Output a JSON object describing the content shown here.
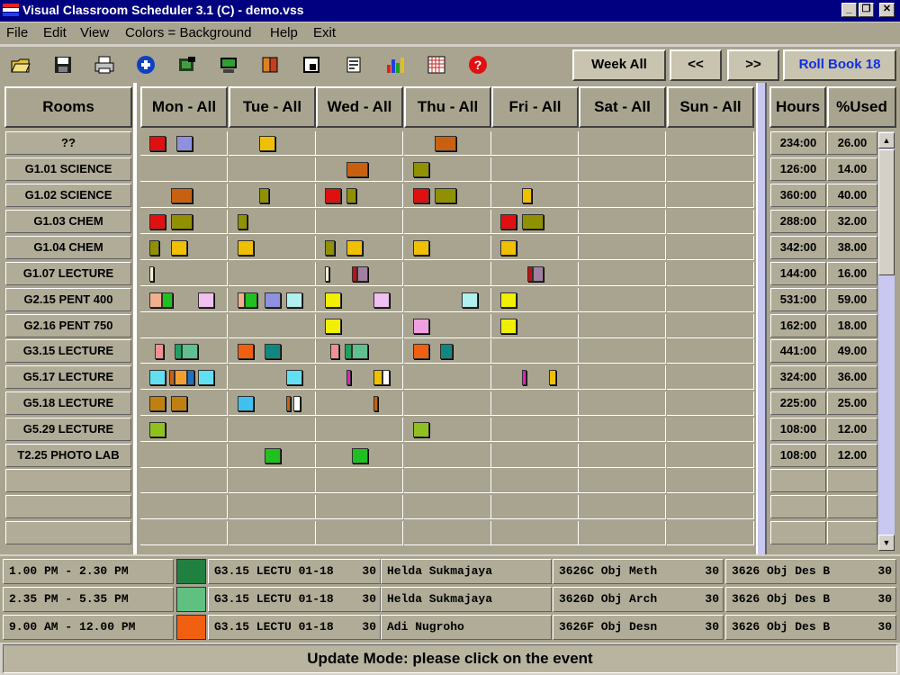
{
  "window": {
    "title": "Visual Classroom Scheduler 3.1 (C) - demo.vss",
    "minimize_label": "_",
    "restore_label": "❐",
    "close_label": "✕"
  },
  "menu": [
    "File",
    "Edit",
    "View",
    "Colors = Background",
    "Help",
    "Exit"
  ],
  "toolbar": {
    "icons": [
      "open-folder-icon",
      "save-disk-icon",
      "print-icon",
      "add-icon",
      "film-icon",
      "computer-icon",
      "books-icon",
      "window-icon",
      "notes-icon",
      "bar-chart-icon",
      "grid-icon",
      "help-icon"
    ],
    "week_all": "Week All",
    "prev": "<<",
    "next": ">>",
    "roll_book": "Roll Book 18"
  },
  "headers": {
    "rooms": "Rooms",
    "days": [
      "Mon - All",
      "Tue - All",
      "Wed - All",
      "Thu - All",
      "Fri - All",
      "Sat - All",
      "Sun - All"
    ],
    "hours": "Hours",
    "used": "%Used"
  },
  "rows": [
    {
      "room": "??",
      "hours": "234:00",
      "used": "26.00"
    },
    {
      "room": "G1.01 SCIENCE",
      "hours": "126:00",
      "used": "14.00"
    },
    {
      "room": "G1.02 SCIENCE",
      "hours": "360:00",
      "used": "40.00"
    },
    {
      "room": "G1.03 CHEM",
      "hours": "288:00",
      "used": "32.00"
    },
    {
      "room": "G1.04 CHEM",
      "hours": "342:00",
      "used": "38.00"
    },
    {
      "room": "G1.07 LECTURE",
      "hours": "144:00",
      "used": "16.00"
    },
    {
      "room": "G2.15 PENT 400",
      "hours": "531:00",
      "used": "59.00"
    },
    {
      "room": "G2.16 PENT 750",
      "hours": "162:00",
      "used": "18.00"
    },
    {
      "room": "G3.15 LECTURE",
      "hours": "441:00",
      "used": "49.00"
    },
    {
      "room": "G5.17 LECTURE",
      "hours": "324:00",
      "used": "36.00"
    },
    {
      "room": "G5.18 LECTURE",
      "hours": "225:00",
      "used": "25.00"
    },
    {
      "room": "G5.29 LECTURE",
      "hours": "108:00",
      "used": "12.00"
    },
    {
      "room": "T2.25 PHOTO LAB",
      "hours": "108:00",
      "used": "12.00"
    },
    {
      "room": "",
      "hours": "",
      "used": ""
    },
    {
      "room": "",
      "hours": "",
      "used": ""
    },
    {
      "room": "",
      "hours": "",
      "used": ""
    }
  ],
  "events": [
    {
      "row": 0,
      "day": 0,
      "color": "#e01010",
      "off": 10,
      "w": 18
    },
    {
      "row": 0,
      "day": 0,
      "color": "#9090e0",
      "off": 40,
      "w": 18
    },
    {
      "row": 0,
      "day": 1,
      "color": "#f0c000",
      "off": 34,
      "w": 18
    },
    {
      "row": 0,
      "day": 3,
      "color": "#c86010",
      "off": 34,
      "w": 24
    },
    {
      "row": 1,
      "day": 2,
      "color": "#c86010",
      "off": 34,
      "w": 24
    },
    {
      "row": 1,
      "day": 3,
      "color": "#909000",
      "off": 10,
      "w": 18
    },
    {
      "row": 2,
      "day": 0,
      "color": "#c86010",
      "off": 34,
      "w": 24
    },
    {
      "row": 2,
      "day": 1,
      "color": "#909000",
      "off": 34,
      "w": 11
    },
    {
      "row": 2,
      "day": 2,
      "color": "#e01010",
      "off": 10,
      "w": 18
    },
    {
      "row": 2,
      "day": 2,
      "color": "#909000",
      "off": 34,
      "w": 11
    },
    {
      "row": 2,
      "day": 3,
      "color": "#e01010",
      "off": 10,
      "w": 18
    },
    {
      "row": 2,
      "day": 3,
      "color": "#909000",
      "off": 34,
      "w": 24
    },
    {
      "row": 2,
      "day": 4,
      "color": "#f0c000",
      "off": 34,
      "w": 11
    },
    {
      "row": 3,
      "day": 0,
      "color": "#e01010",
      "off": 10,
      "w": 18
    },
    {
      "row": 3,
      "day": 0,
      "color": "#909000",
      "off": 34,
      "w": 24
    },
    {
      "row": 3,
      "day": 1,
      "color": "#909000",
      "off": 10,
      "w": 11
    },
    {
      "row": 3,
      "day": 4,
      "color": "#e01010",
      "off": 10,
      "w": 18
    },
    {
      "row": 3,
      "day": 4,
      "color": "#909000",
      "off": 34,
      "w": 24
    },
    {
      "row": 4,
      "day": 0,
      "color": "#909000",
      "off": 10,
      "w": 11
    },
    {
      "row": 4,
      "day": 0,
      "color": "#f0c000",
      "off": 34,
      "w": 18
    },
    {
      "row": 4,
      "day": 1,
      "color": "#f0c000",
      "off": 10,
      "w": 18
    },
    {
      "row": 4,
      "day": 2,
      "color": "#909000",
      "off": 10,
      "w": 11
    },
    {
      "row": 4,
      "day": 2,
      "color": "#f0c000",
      "off": 34,
      "w": 18
    },
    {
      "row": 4,
      "day": 3,
      "color": "#f0c000",
      "off": 10,
      "w": 18
    },
    {
      "row": 4,
      "day": 4,
      "color": "#f0c000",
      "off": 10,
      "w": 18
    },
    {
      "row": 5,
      "day": 0,
      "color": "#f0f0d0",
      "off": 10,
      "w": 5
    },
    {
      "row": 5,
      "day": 2,
      "color": "#f0f0d0",
      "off": 10,
      "w": 5
    },
    {
      "row": 5,
      "day": 2,
      "color": "#c01010",
      "off": 40,
      "w": 6
    },
    {
      "row": 5,
      "day": 2,
      "color": "#a080a0",
      "off": 46,
      "w": 12
    },
    {
      "row": 5,
      "day": 4,
      "color": "#c01010",
      "off": 40,
      "w": 6
    },
    {
      "row": 5,
      "day": 4,
      "color": "#a080a0",
      "off": 46,
      "w": 12
    },
    {
      "row": 6,
      "day": 0,
      "color": "#f0b090",
      "off": 10,
      "w": 14
    },
    {
      "row": 6,
      "day": 0,
      "color": "#20c020",
      "off": 24,
      "w": 12
    },
    {
      "row": 6,
      "day": 0,
      "color": "#f0c0f0",
      "off": 64,
      "w": 18
    },
    {
      "row": 6,
      "day": 1,
      "color": "#f0b090",
      "off": 10,
      "w": 8
    },
    {
      "row": 6,
      "day": 1,
      "color": "#20c020",
      "off": 18,
      "w": 14
    },
    {
      "row": 6,
      "day": 1,
      "color": "#9090e0",
      "off": 40,
      "w": 18
    },
    {
      "row": 6,
      "day": 1,
      "color": "#b0f0f0",
      "off": 64,
      "w": 18
    },
    {
      "row": 6,
      "day": 2,
      "color": "#f0f000",
      "off": 10,
      "w": 18
    },
    {
      "row": 6,
      "day": 2,
      "color": "#f0c0f0",
      "off": 64,
      "w": 18
    },
    {
      "row": 6,
      "day": 3,
      "color": "#b0f0f0",
      "off": 64,
      "w": 18
    },
    {
      "row": 6,
      "day": 4,
      "color": "#f0f000",
      "off": 10,
      "w": 18
    },
    {
      "row": 7,
      "day": 2,
      "color": "#f0f000",
      "off": 10,
      "w": 18
    },
    {
      "row": 7,
      "day": 3,
      "color": "#f0a0e0",
      "off": 10,
      "w": 18
    },
    {
      "row": 7,
      "day": 4,
      "color": "#f0f000",
      "off": 10,
      "w": 18
    },
    {
      "row": 8,
      "day": 0,
      "color": "#f09090",
      "off": 16,
      "w": 10
    },
    {
      "row": 8,
      "day": 0,
      "color": "#20a060",
      "off": 38,
      "w": 8
    },
    {
      "row": 8,
      "day": 0,
      "color": "#60c090",
      "off": 46,
      "w": 18
    },
    {
      "row": 8,
      "day": 1,
      "color": "#f06010",
      "off": 10,
      "w": 18
    },
    {
      "row": 8,
      "day": 1,
      "color": "#108880",
      "off": 40,
      "w": 18
    },
    {
      "row": 8,
      "day": 2,
      "color": "#f09090",
      "off": 16,
      "w": 10
    },
    {
      "row": 8,
      "day": 2,
      "color": "#20a060",
      "off": 32,
      "w": 8
    },
    {
      "row": 8,
      "day": 2,
      "color": "#60c090",
      "off": 40,
      "w": 18
    },
    {
      "row": 8,
      "day": 3,
      "color": "#f06010",
      "off": 10,
      "w": 18
    },
    {
      "row": 8,
      "day": 3,
      "color": "#108880",
      "off": 40,
      "w": 14
    },
    {
      "row": 9,
      "day": 0,
      "color": "#60e0f0",
      "off": 10,
      "w": 18
    },
    {
      "row": 9,
      "day": 0,
      "color": "#c86010",
      "off": 32,
      "w": 6
    },
    {
      "row": 9,
      "day": 0,
      "color": "#f0a030",
      "off": 38,
      "w": 14
    },
    {
      "row": 9,
      "day": 0,
      "color": "#2070c0",
      "off": 52,
      "w": 8
    },
    {
      "row": 9,
      "day": 0,
      "color": "#60e0f0",
      "off": 64,
      "w": 18
    },
    {
      "row": 9,
      "day": 1,
      "color": "#60e0f0",
      "off": 64,
      "w": 18
    },
    {
      "row": 9,
      "day": 2,
      "color": "#e020c0",
      "off": 34,
      "w": 5
    },
    {
      "row": 9,
      "day": 2,
      "color": "#f0c000",
      "off": 64,
      "w": 10
    },
    {
      "row": 9,
      "day": 2,
      "color": "#ffffff",
      "off": 74,
      "w": 8
    },
    {
      "row": 9,
      "day": 4,
      "color": "#e020c0",
      "off": 34,
      "w": 5
    },
    {
      "row": 9,
      "day": 4,
      "color": "#f0c000",
      "off": 64,
      "w": 8
    },
    {
      "row": 10,
      "day": 0,
      "color": "#c08010",
      "off": 10,
      "w": 18
    },
    {
      "row": 10,
      "day": 0,
      "color": "#c08010",
      "off": 34,
      "w": 18
    },
    {
      "row": 10,
      "day": 1,
      "color": "#40c0f0",
      "off": 10,
      "w": 18
    },
    {
      "row": 10,
      "day": 1,
      "color": "#c86010",
      "off": 64,
      "w": 5
    },
    {
      "row": 10,
      "day": 1,
      "color": "#ffffff",
      "off": 72,
      "w": 8
    },
    {
      "row": 10,
      "day": 2,
      "color": "#c86010",
      "off": 64,
      "w": 5
    },
    {
      "row": 11,
      "day": 0,
      "color": "#90c020",
      "off": 10,
      "w": 18
    },
    {
      "row": 11,
      "day": 3,
      "color": "#90c020",
      "off": 10,
      "w": 18
    },
    {
      "row": 12,
      "day": 1,
      "color": "#20c020",
      "off": 40,
      "w": 18
    },
    {
      "row": 12,
      "day": 2,
      "color": "#20c020",
      "off": 40,
      "w": 18
    }
  ],
  "details": [
    {
      "time": "1.00 PM - 2.30 PM",
      "color": "#208040",
      "room": "G3.15 LECTU 01-18",
      "count": "30",
      "teacher": "Helda Sukmajaya",
      "course": "3626C Obj Meth",
      "course_count": "30",
      "subject": "3626 Obj Des B",
      "subject_count": "30"
    },
    {
      "time": "2.35 PM - 5.35 PM",
      "color": "#60c080",
      "room": "G3.15 LECTU 01-18",
      "count": "30",
      "teacher": "Helda Sukmajaya",
      "course": "3626D Obj Arch",
      "course_count": "30",
      "subject": "3626 Obj Des B",
      "subject_count": "30"
    },
    {
      "time": "9.00 AM - 12.00 PM",
      "color": "#f06010",
      "room": "G3.15 LECTU 01-18",
      "count": "30",
      "teacher": "Adi Nugroho",
      "course": "3626F Obj Desn",
      "course_count": "30",
      "subject": "3626 Obj Des B",
      "subject_count": "30"
    }
  ],
  "status": "Update Mode: please click on the event"
}
